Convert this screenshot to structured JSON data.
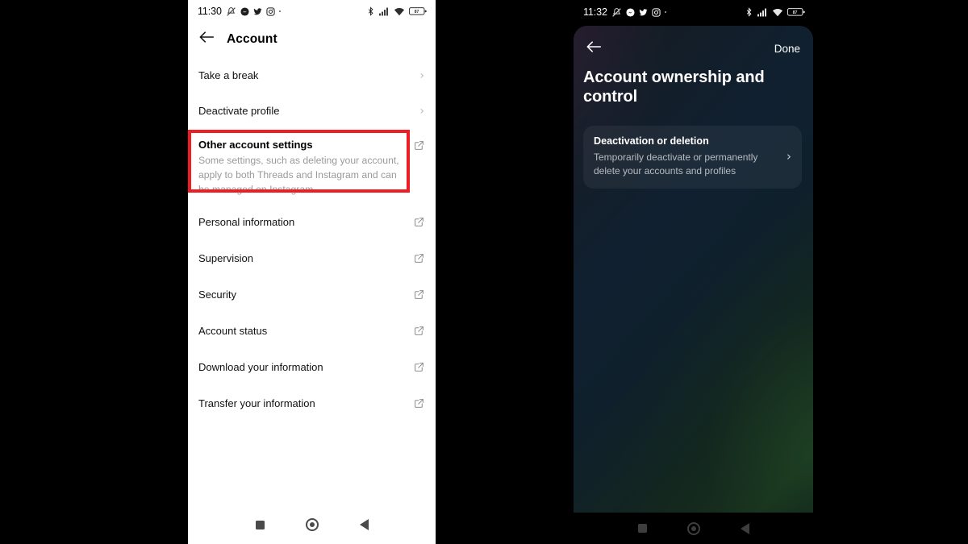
{
  "left_phone": {
    "status_bar": {
      "time": "11:30",
      "left_icons": [
        "silent-mode-icon",
        "messenger-icon",
        "twitter-icon",
        "instagram-icon",
        "more-dot-icon"
      ],
      "right_icons": [
        "bluetooth-icon",
        "cellular-signal-icon",
        "wifi-icon",
        "battery-icon"
      ],
      "battery_level": "87"
    },
    "header": {
      "back_label": "back-arrow",
      "title": "Account"
    },
    "rows": [
      {
        "title": "Take a break",
        "subtitle": "",
        "accessory": "chevron"
      },
      {
        "title": "Deactivate profile",
        "subtitle": "",
        "accessory": "chevron"
      },
      {
        "title": "Other account settings",
        "subtitle": "Some settings, such as deleting your account, apply to both Threads and Instagram and can be managed on Instagram.",
        "accessory": "external-link",
        "highlighted": true
      },
      {
        "title": "Personal information",
        "subtitle": "",
        "accessory": "external-link"
      },
      {
        "title": "Supervision",
        "subtitle": "",
        "accessory": "external-link"
      },
      {
        "title": "Security",
        "subtitle": "",
        "accessory": "external-link"
      },
      {
        "title": "Account status",
        "subtitle": "",
        "accessory": "external-link"
      },
      {
        "title": "Download your information",
        "subtitle": "",
        "accessory": "external-link"
      },
      {
        "title": "Transfer your information",
        "subtitle": "",
        "accessory": "external-link"
      }
    ],
    "highlight_color": "#ee1c23",
    "nav_bar": [
      "recents-button",
      "home-button",
      "back-button"
    ]
  },
  "right_phone": {
    "status_bar": {
      "time": "11:32",
      "left_icons": [
        "silent-mode-icon",
        "messenger-icon",
        "twitter-icon",
        "instagram-icon",
        "more-dot-icon"
      ],
      "right_icons": [
        "bluetooth-icon",
        "cellular-signal-icon",
        "wifi-icon",
        "battery-icon"
      ],
      "battery_level": "87"
    },
    "sheet": {
      "back_label": "back-arrow",
      "done_label": "Done",
      "title": "Account ownership and control",
      "card": {
        "title": "Deactivation or deletion",
        "subtitle": "Temporarily deactivate or permanently delete your accounts and profiles",
        "accessory": "chevron"
      }
    },
    "nav_bar": [
      "recents-button",
      "home-button",
      "back-button"
    ]
  }
}
